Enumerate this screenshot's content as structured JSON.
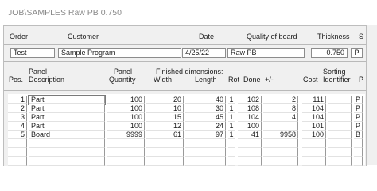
{
  "window": {
    "title": "JOB\\SAMPLES  Raw PB  0.750"
  },
  "header_labels": {
    "order": "Order",
    "customer": "Customer",
    "date": "Date",
    "quality": "Quality of board",
    "thickness": "Thickness",
    "s": "S"
  },
  "order_fields": {
    "order": "Test",
    "customer": "Sample Program",
    "date": "4/25/22",
    "quality": "Raw PB",
    "thickness": "0.750",
    "s": "P"
  },
  "column_headers": {
    "pos": "Pos.",
    "panel_top": "Panel",
    "description": "Description",
    "panel_qty_top": "Panel",
    "quantity": "Quantity",
    "finished_dimensions": "Finished dimensions:",
    "width": "Width",
    "length": "Length",
    "rot": "Rot",
    "done": "Done",
    "plusminus": "+/-",
    "cost": "Cost",
    "sorting": "Sorting",
    "identifier": "Identifier",
    "p": "P"
  },
  "rows": [
    {
      "pos": "1",
      "description": "Part",
      "quantity": "100",
      "width": "20",
      "length": "40",
      "rot": "1",
      "done": "102",
      "plusminus": "2",
      "cost": "111",
      "identifier": "",
      "p": "P"
    },
    {
      "pos": "2",
      "description": "Part",
      "quantity": "100",
      "width": "10",
      "length": "30",
      "rot": "1",
      "done": "108",
      "plusminus": "8",
      "cost": "104",
      "identifier": "",
      "p": "P"
    },
    {
      "pos": "3",
      "description": "Part",
      "quantity": "100",
      "width": "15",
      "length": "45",
      "rot": "1",
      "done": "104",
      "plusminus": "4",
      "cost": "104",
      "identifier": "",
      "p": "P"
    },
    {
      "pos": "4",
      "description": "Part",
      "quantity": "100",
      "width": "12",
      "length": "24",
      "rot": "1",
      "done": "100",
      "plusminus": "",
      "cost": "101",
      "identifier": "",
      "p": "P"
    },
    {
      "pos": "5",
      "description": "Board",
      "quantity": "9999",
      "width": "61",
      "length": "97",
      "rot": "1",
      "done": "41",
      "plusminus": "9958",
      "cost": "100",
      "identifier": "",
      "p": "B"
    },
    {
      "pos": "",
      "description": "",
      "quantity": "",
      "width": "",
      "length": "",
      "rot": "",
      "done": "",
      "plusminus": "",
      "cost": "",
      "identifier": "",
      "p": ""
    },
    {
      "pos": "",
      "description": "",
      "quantity": "",
      "width": "",
      "length": "",
      "rot": "",
      "done": "",
      "plusminus": "",
      "cost": "",
      "identifier": "",
      "p": ""
    },
    {
      "pos": "",
      "description": "",
      "quantity": "",
      "width": "",
      "length": "",
      "rot": "",
      "done": "",
      "plusminus": "",
      "cost": "",
      "identifier": "",
      "p": ""
    }
  ]
}
